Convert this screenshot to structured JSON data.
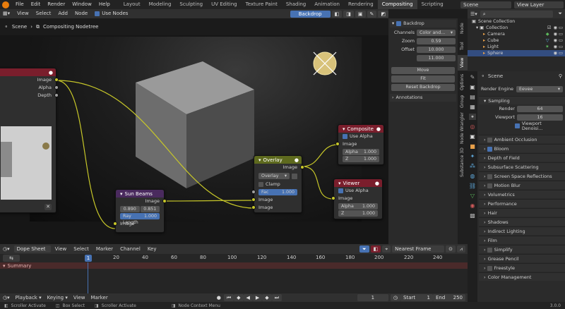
{
  "topbar": {
    "menus": [
      "File",
      "Edit",
      "Render",
      "Window",
      "Help"
    ],
    "workspaces": [
      "Layout",
      "Modeling",
      "Sculpting",
      "UV Editing",
      "Texture Paint",
      "Shading",
      "Animation",
      "Rendering",
      "Compositing",
      "Scripting"
    ],
    "active_workspace": "Compositing",
    "scene": "Scene",
    "view_layer": "View Layer"
  },
  "node_editor": {
    "menus": [
      "View",
      "Select",
      "Add",
      "Node"
    ],
    "use_nodes": "Use Nodes",
    "backdrop_label": "Backdrop",
    "breadcrumb_scene": "Scene",
    "breadcrumb_tree": "Compositing Nodetree"
  },
  "nodes": {
    "render_layers": {
      "outputs": [
        "Image",
        "Alpha",
        "Depth"
      ]
    },
    "sun_beams": {
      "title": "Sun Beams",
      "out": "Image",
      "x": "0.890",
      "y": "0.851",
      "ray_label": "Ray Length",
      "ray_value": "1.000",
      "in": "Image"
    },
    "overlay": {
      "title": "Overlay",
      "out": "Image",
      "mode": "Overlay",
      "clamp": "Clamp",
      "fac_label": "Fac",
      "fac_value": "1.000",
      "in1": "Image",
      "in2": "Image"
    },
    "composite": {
      "title": "Composite",
      "use_alpha": "Use Alpha",
      "in": "Image",
      "alpha_label": "Alpha",
      "alpha_value": "1.000",
      "z_label": "Z",
      "z_value": "1.000"
    },
    "viewer": {
      "title": "Viewer",
      "use_alpha": "Use Alpha",
      "in": "Image",
      "alpha_label": "Alpha",
      "alpha_value": "1.000",
      "z_label": "Z",
      "z_value": "1.000"
    }
  },
  "npanel": {
    "backdrop": "Backdrop",
    "channels_label": "Channels",
    "channels_value": "Color and...",
    "zoom_label": "Zoom",
    "zoom_value": "0.59",
    "offset_label": "Offset",
    "offset_x": "10.000",
    "offset_y": "11.000",
    "move": "Move",
    "fit": "Fit",
    "reset": "Reset Backdrop",
    "annotations": "Annotations",
    "tabs": [
      "Node",
      "Tool",
      "View",
      "Options",
      "Group",
      "Node Wrangler",
      "Substance 3D"
    ]
  },
  "outliner": {
    "scene_collection": "Scene Collection",
    "items": [
      "Collection",
      "Camera",
      "Cube",
      "Light",
      "Sphere"
    ]
  },
  "properties": {
    "title": "Scene",
    "render_engine_label": "Render Engine",
    "render_engine": "Eevee",
    "sampling": "Sampling",
    "render_label": "Render",
    "render_value": "64",
    "viewport_label": "Viewport",
    "viewport_value": "16",
    "viewport_denoise": "Viewport Denoisi...",
    "panels": [
      "Ambient Occlusion",
      "Bloom",
      "Depth of Field",
      "Subsurface Scattering",
      "Screen Space Reflections",
      "Motion Blur",
      "Volumetrics",
      "Performance",
      "Hair",
      "Shadows",
      "Indirect Lighting",
      "Film",
      "Simplify",
      "Grease Pencil",
      "Freestyle",
      "Color Management"
    ]
  },
  "timeline": {
    "editor": "Dope Sheet",
    "menus": [
      "View",
      "Select",
      "Marker",
      "Channel",
      "Key"
    ],
    "snap": "Nearest Frame",
    "ruler": [
      "1",
      "20",
      "40",
      "60",
      "80",
      "100",
      "120",
      "140",
      "160",
      "180",
      "200",
      "220",
      "240"
    ],
    "current_frame": "1",
    "summary": "Summary",
    "playback": "Playback",
    "keying": "Keying",
    "view": "View",
    "marker": "Marker",
    "frame": "1",
    "start_label": "Start",
    "start": "1",
    "end_label": "End",
    "end": "250"
  },
  "status": {
    "left1": "Scroller Activate",
    "left2": "Box Select",
    "left3": "Scroller Activate",
    "mid": "Node Context Menu",
    "version": "3.0.0"
  },
  "colors": {
    "accent": "#4772b3",
    "socket_yellow": "#c7c729",
    "composite_header": "#7a1e2c",
    "sunbeams_header": "#4a2a5e",
    "overlay_header": "#5e6a1e"
  }
}
